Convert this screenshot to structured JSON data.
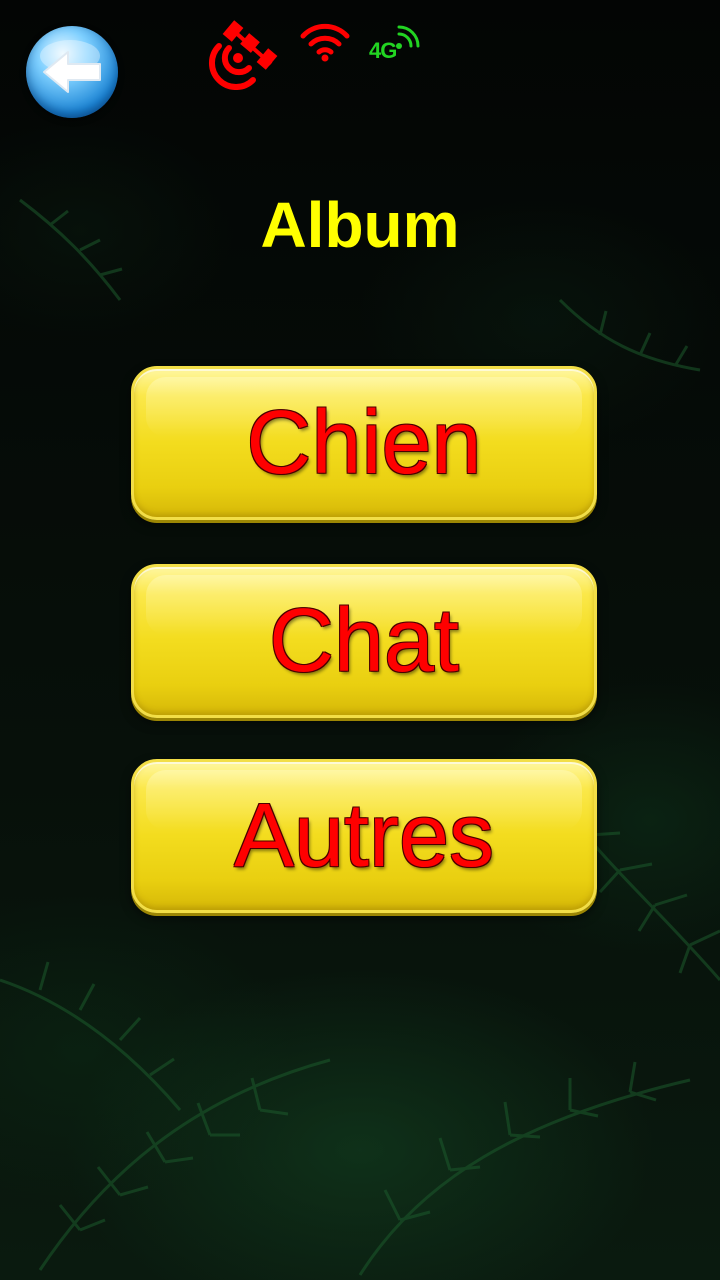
{
  "header": {
    "back_icon": "back-arrow-icon",
    "status": {
      "satellite_icon": "satellite-icon",
      "wifi_icon": "wifi-icon",
      "network_label": "4G",
      "status_color": "#ff0000",
      "network_color": "#22d422"
    }
  },
  "page": {
    "title": "Album",
    "title_color": "#ffff00"
  },
  "menu": {
    "items": [
      {
        "label": "Chien"
      },
      {
        "label": "Chat"
      },
      {
        "label": "Autres"
      }
    ],
    "button_color": "#f3dc1e",
    "label_color": "#ff0000"
  }
}
